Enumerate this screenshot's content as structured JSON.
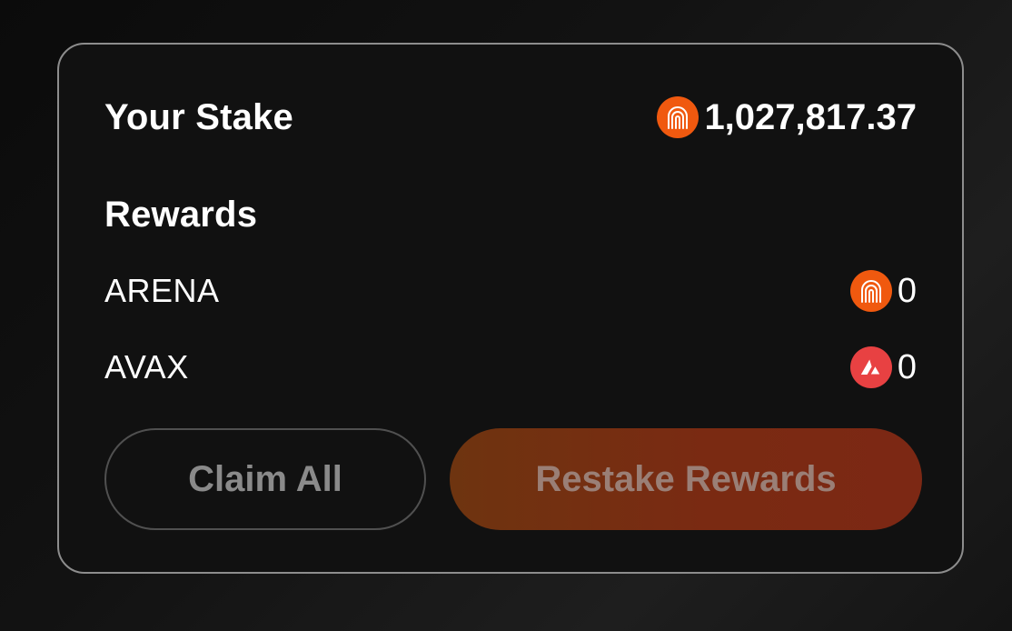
{
  "stake": {
    "label": "Your Stake",
    "value": "1,027,817.37",
    "token_icon": "arena-token-icon"
  },
  "rewards": {
    "heading": "Rewards",
    "items": [
      {
        "token": "ARENA",
        "value": "0",
        "icon": "arena-token-icon"
      },
      {
        "token": "AVAX",
        "value": "0",
        "icon": "avax-token-icon"
      }
    ]
  },
  "actions": {
    "claim_all_label": "Claim All",
    "restake_label": "Restake Rewards"
  },
  "colors": {
    "arena": "#f0590f",
    "avax": "#e84142",
    "card_border": "#8d8d8d"
  }
}
